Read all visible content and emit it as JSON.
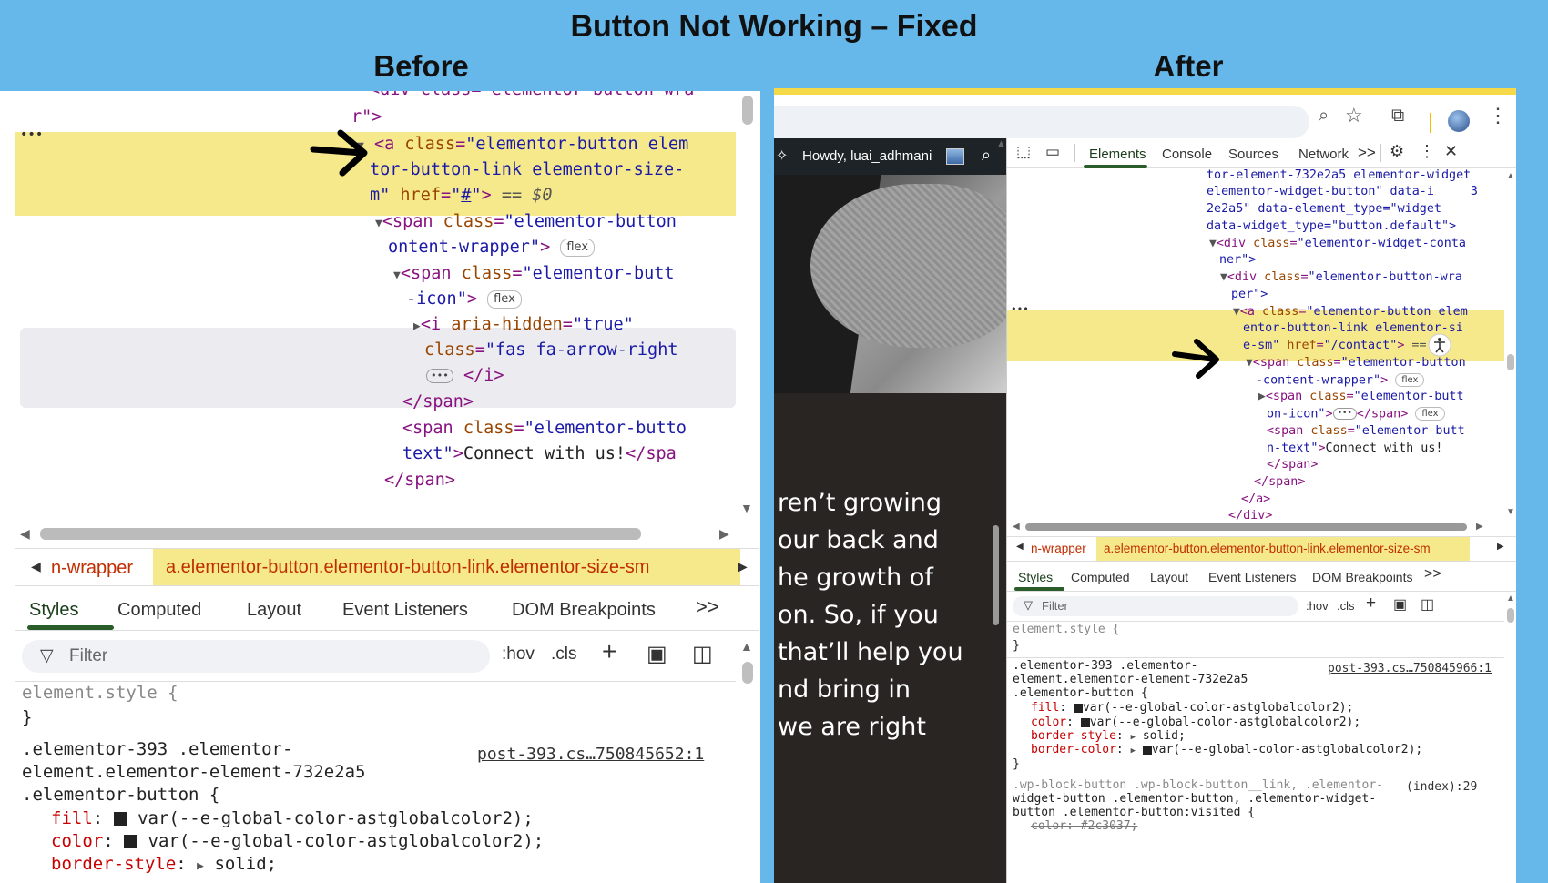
{
  "title": "Button Not Working – Fixed",
  "labels": {
    "before": "Before",
    "after": "After"
  },
  "before": {
    "tree_lines": {
      "l0": "<div class=\"elementor-button-wra",
      "l1": "r\">",
      "dots": "•••",
      "a1_tag": "<a ",
      "a1_an": "class",
      "a1_av": "\"elementor-button elem",
      "a2": "tor-button-link elementor-size-",
      "a3_av": "m\"",
      "a3_an": " href",
      "a3_eq": "=\"",
      "a3_href": "#",
      "a3_end": "\">",
      "a3_dollar": " == $0",
      "s1_tag": "<span ",
      "s1_an": "class",
      "s1_av": "\"elementor-button",
      "s1b_av": "ontent-wrapper\"",
      "s1b_tag": ">",
      "flex": "flex",
      "s2_tag": "<span ",
      "s2_an": "class",
      "s2_av": "\"elementor-butt",
      "s2b_av": "-icon\"",
      "s2b_tag": ">",
      "i1_tag": "<i ",
      "i1_an": "aria-hidden",
      "i1_av": "\"true\"",
      "i2_an": "class",
      "i2_av": "\"fas fa-arrow-right",
      "i3_ell": "•••",
      "i3_tag": "</i>",
      "span_close": "</span>",
      "s3_tag": "<span ",
      "s3_an": "class",
      "s3_av": "\"elementor-butto",
      "s3b_av": "text\"",
      "s3b_tag": ">",
      "s3b_text": "Connect with us!",
      "s3b_close": "</spa",
      "span_close2": "</span>"
    },
    "breadcrumb": {
      "prev": "n-wrapper",
      "selected": "a.elementor-button.elementor-button-link.elementor-size-sm"
    },
    "tabs": [
      "Styles",
      "Computed",
      "Layout",
      "Event Listeners",
      "DOM Breakpoints"
    ],
    "tabs_more": ">>",
    "filter_placeholder": "Filter",
    "tools": {
      "hov": ":hov",
      "cls": ".cls"
    },
    "rules": {
      "element_style": "element.style {",
      "close": "}",
      "sel1": ".elementor-393 .elementor-",
      "sel2": "element.elementor-element-732e2a5",
      "sel3": ".elementor-button {",
      "source": "post-393.cs…750845652:1",
      "p1n": "fill",
      "p1v": "var(--e-global-color-astglobalcolor2);",
      "p2n": "color",
      "p2v": "var(--e-global-color-astglobalcolor2);",
      "p3n": "border-style",
      "p3v": "solid;"
    }
  },
  "after": {
    "site": {
      "admin_greeting": "Howdy, luai_adhmani",
      "text_lines": [
        "ren’t growing",
        "our back and",
        "he growth of",
        "on. So, if you",
        "that’ll help you",
        "nd bring in",
        "we are right"
      ]
    },
    "devtools_tabs": [
      "Elements",
      "Console",
      "Sources",
      "Network"
    ],
    "devtools_more": ">>",
    "tree_lines": {
      "l1": "tor-element-732e2a5 elementor-widget",
      "l2": "elementor-widget-button\" data-i",
      "l2b": "3",
      "l3": "2e2a5\" data-element_type=\"widget",
      "l4": "data-widget_type=\"button.default\">",
      "l5_tag": "<div ",
      "l5_an": "class",
      "l5_av": "\"elementor-widget-conta",
      "l6": "ner\">",
      "l7_tag": "<div ",
      "l7_an": "class",
      "l7_av": "\"elementor-button-wra",
      "l8": "per\">",
      "dots": "•••",
      "a1_tag": "<a ",
      "a1_an": "class",
      "a1_av": "\"elementor-button elem",
      "a2": "entor-button-link elementor-si",
      "a3_av": "e-sm\"",
      "a3_an": " href",
      "a3_eq": "=\"",
      "a3_href": "/contact",
      "a3_end": "\">",
      "a3_dollar": " == $0",
      "s1_tag": "<span ",
      "s1_an": "class",
      "s1_av": "\"elementor-button",
      "s1b_av": "-content-wrapper\"",
      "s1b_tag": ">",
      "flex": "flex",
      "s2_tag": "<span ",
      "s2_an": "class",
      "s2_av": "\"elementor-butt",
      "s2b_av": "on-icon\"",
      "s2b_tag": ">",
      "s2b_ell": "•••",
      "s2b_close": "</span>",
      "s3_tag": "<span ",
      "s3_an": "class",
      "s3_av": "\"elementor-butt",
      "s3b_av": "n-text\"",
      "s3b_tag": ">",
      "s3b_text": "Connect with us!",
      "span_close": "</span>",
      "span_close2": "</span>",
      "a_close": "</a>",
      "div_close": "</div>"
    },
    "breadcrumb": {
      "prev": "n-wrapper",
      "selected": "a.elementor-button.elementor-button-link.elementor-size-sm"
    },
    "tabs": [
      "Styles",
      "Computed",
      "Layout",
      "Event Listeners",
      "DOM Breakpoints"
    ],
    "tabs_more": ">>",
    "filter_placeholder": "Filter",
    "tools": {
      "hov": ":hov",
      "cls": ".cls"
    },
    "rules": {
      "element_style": "element.style {",
      "close": "}",
      "sel1": ".elementor-393 .elementor-",
      "sel2": "element.elementor-element-732e2a5",
      "sel3": ".elementor-button {",
      "source": "post-393.cs…750845966:1",
      "p1n": "fill",
      "p1v": "var(--e-global-color-astglobalcolor2);",
      "p2n": "color",
      "p2v": "var(--e-global-color-astglobalcolor2);",
      "p3n": "border-style",
      "p3v": "solid;",
      "p4n": "border-color",
      "p4v": "var(--e-global-color-astglobalcolor2);",
      "close2": "}",
      "r2a": ".wp-block-button .wp-block-button__link, .elementor-",
      "r2b": "widget-button .elementor-button, .elementor-widget-",
      "r2c": "button .elementor-button:visited {",
      "r2src": "(index):29",
      "r2d": "color: #2c3037;"
    }
  }
}
